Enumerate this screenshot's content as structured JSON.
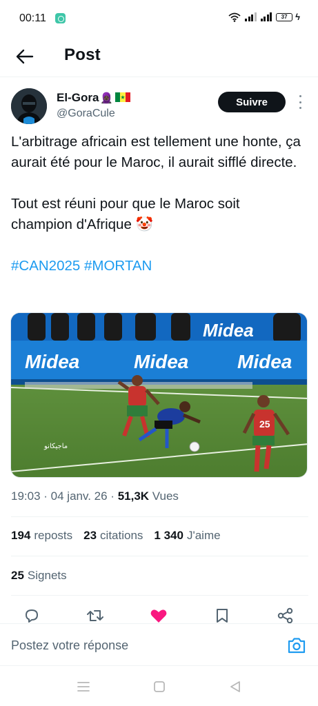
{
  "status_bar": {
    "time": "00:11",
    "battery": "37"
  },
  "header": {
    "title": "Post"
  },
  "author": {
    "display_name": "El-Gora",
    "name_emoji": "🧕🏿",
    "handle": "@GoraCule",
    "follow_label": "Suivre"
  },
  "post": {
    "paragraphs": [
      "L'arbitrage africain est tellement une honte, ça aurait été pour le Maroc, il aurait sifflé directe.",
      "Tout est réuni pour que le Maroc soit champion d'Afrique 🤡"
    ],
    "hashtags": [
      "#CAN2025",
      "#MORTAN"
    ]
  },
  "media": {
    "board_text": "Midea",
    "watermark": "ماجيكانو",
    "player_number": "25"
  },
  "meta": {
    "time": "19:03",
    "separator": " · ",
    "date": "04 janv. 26",
    "views_count": "51,3K",
    "views_label": "Vues"
  },
  "stats": {
    "reposts_count": "194",
    "reposts_label": "reposts",
    "quotes_count": "23",
    "quotes_label": "citations",
    "likes_count": "1 340",
    "likes_label": "J'aime",
    "bookmarks_count": "25",
    "bookmarks_label": "Signets"
  },
  "reply": {
    "placeholder": "Postez votre réponse"
  },
  "icons": {
    "back": "arrow-left-icon",
    "more": "vertical-dots-icon",
    "reply": "speech-bubble-icon",
    "repost": "repost-arrows-icon",
    "like": "heart-icon",
    "bookmark": "bookmark-icon",
    "share": "share-icon",
    "camera": "camera-icon"
  },
  "colors": {
    "accent": "#1d9bf0",
    "like": "#f91880",
    "follow_button": "#0f1419",
    "secondary_text": "#536471"
  }
}
